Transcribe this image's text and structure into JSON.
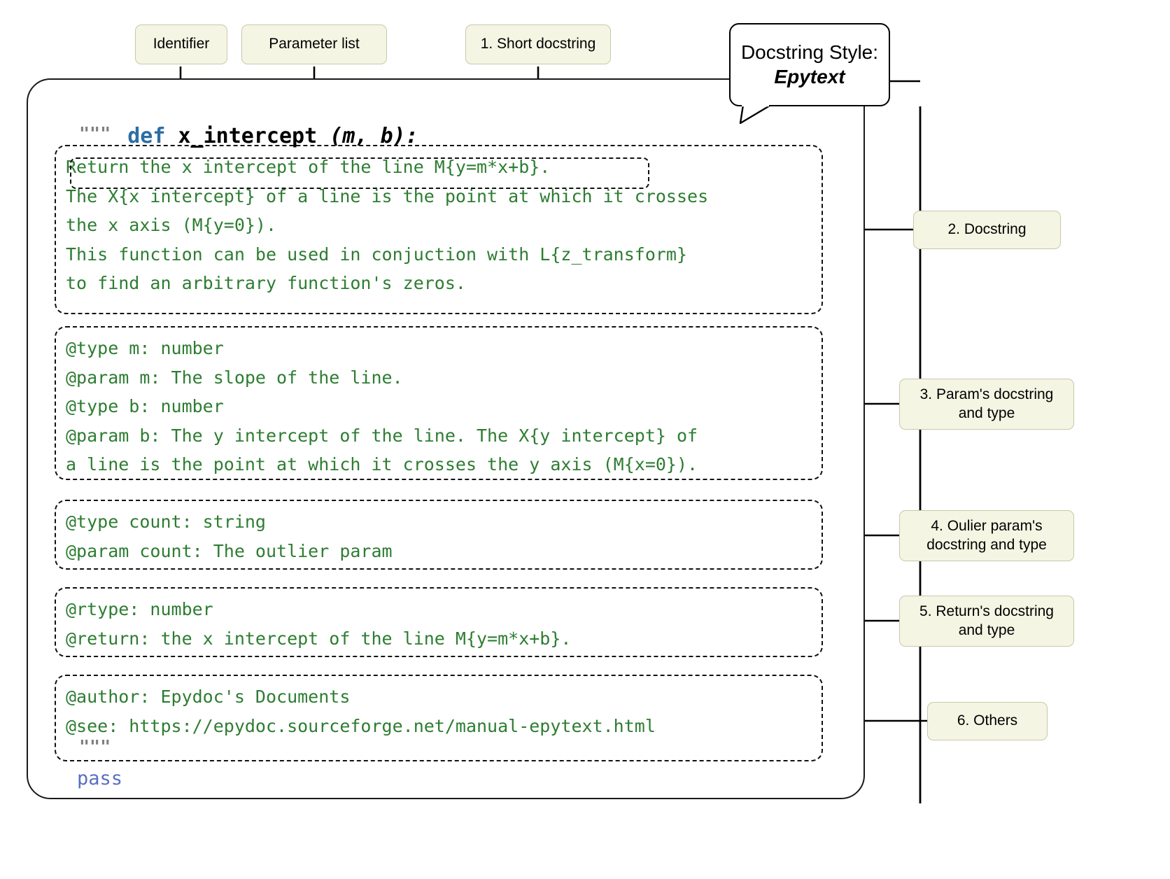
{
  "colors": {
    "anno_fill": "#f5f5e4",
    "anno_border": "#c8c8ac",
    "code_text_green": "#2e7d32",
    "keyword_blue": "#2e6da4",
    "pass_blue": "#5a6fc0",
    "quote_gray": "#808080",
    "frame_border": "#1a1a1a"
  },
  "top_labels": {
    "identifier": "Identifier",
    "parameter_list": "Parameter list",
    "short_docstring": "1. Short docstring"
  },
  "style_bubble": {
    "title": "Docstring Style:",
    "style_name": "Epytext"
  },
  "signature": {
    "keyword": "def",
    "name": "x_intercept",
    "params": "(m, b):"
  },
  "triple_quote_open": "\"\"\"",
  "triple_quote_close": "\"\"\"",
  "statement": "pass",
  "blocks": {
    "docstring": {
      "lines": [
        "Return the x intercept of the line M{y=m*x+b}.",
        "The X{x intercept} of a line is the point at which it crosses",
        "the x axis (M{y=0}).",
        "This function can be used in conjuction with L{z_transform}",
        "to find an arbitrary function's zeros."
      ]
    },
    "params": {
      "lines": [
        "@type m: number",
        "@param m: The slope of the line.",
        "@type b: number",
        "@param b: The y intercept of the line. The X{y intercept} of",
        "a line is the point at which it crosses the y axis (M{x=0})."
      ]
    },
    "outlier": {
      "lines": [
        "@type count: string",
        "@param count: The outlier param"
      ]
    },
    "returns": {
      "lines": [
        "@rtype: number",
        "@return: the x intercept of the line M{y=m*x+b}."
      ]
    },
    "others": {
      "lines": [
        "@author: Epydoc's Documents",
        "@see: https://epydoc.sourceforge.net/manual-epytext.html"
      ]
    }
  },
  "right_labels": {
    "docstring": "2. Docstring",
    "param_docstring": "3. Param's docstring\nand type",
    "outlier_param": "4. Oulier param's\ndocstring and type",
    "return_docstring": "5. Return's docstring\nand type",
    "others": "6. Others"
  }
}
